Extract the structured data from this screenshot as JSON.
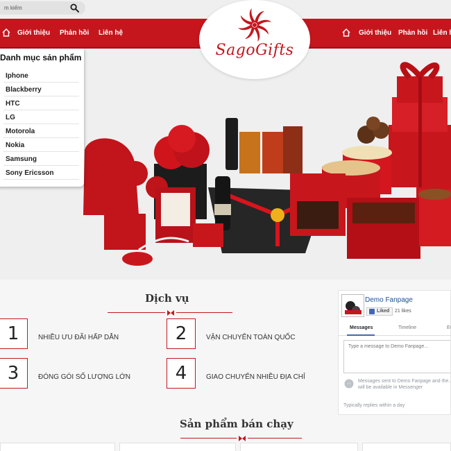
{
  "search": {
    "value": "m kiếm"
  },
  "nav": {
    "left": [
      "Giới thiệu",
      "Phản hồi",
      "Liên hệ"
    ],
    "right": [
      "Giới thiệu",
      "Phản hồi",
      "Liên h"
    ]
  },
  "logo": {
    "wordmark": "SagoGifts"
  },
  "categories": {
    "title": "Danh mục sản phẩm",
    "items": [
      "Iphone",
      "Blackberry",
      "HTC",
      "LG",
      "Motorola",
      "Nokia",
      "Samsung",
      "Sony Ericsson"
    ]
  },
  "services": {
    "title": "Dịch vụ",
    "items": [
      {
        "number": "1",
        "text": "Nhiều ưu đãi hấp dẫn"
      },
      {
        "number": "2",
        "text": "Vận chuyển toàn quốc"
      },
      {
        "number": "3",
        "text": "Đóng gói số lượng lớn"
      },
      {
        "number": "4",
        "text": "Giao chuyển nhiều địa chỉ"
      }
    ]
  },
  "bestsellers": {
    "title": "Sản phẩm bán chạy"
  },
  "fanpage": {
    "name": "Demo Fanpage",
    "liked_label": "Liked",
    "likes": "21 likes",
    "tabs": [
      "Messages",
      "Timeline",
      "Ev"
    ],
    "message_placeholder": "Type a message to Demo Fanpage...",
    "notice": "Messages sent to Demo Fanpage and the… will be available in Messenger",
    "replies": "Typically replies within a day"
  },
  "colors": {
    "brand_red": "#c5161d",
    "facebook_blue": "#4267b2"
  }
}
